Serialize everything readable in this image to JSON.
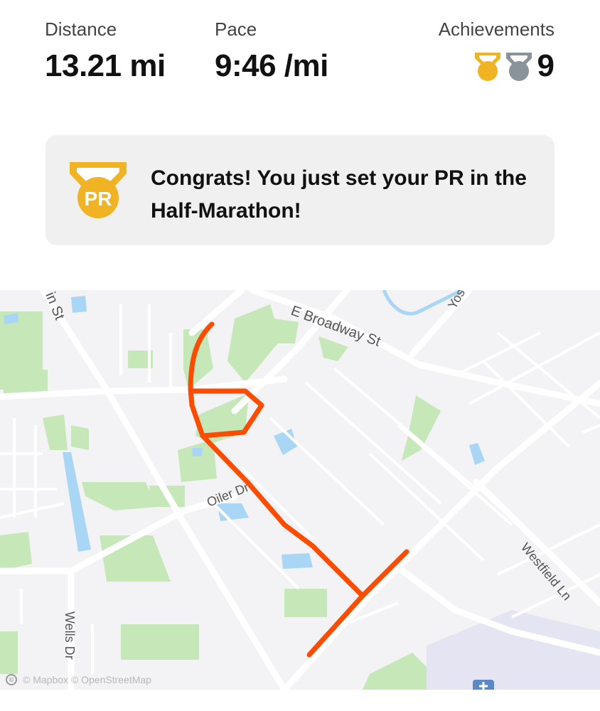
{
  "stats": {
    "distance": {
      "label": "Distance",
      "value": "13.21 mi"
    },
    "pace": {
      "label": "Pace",
      "value": "9:46 /mi"
    },
    "achievements": {
      "label": "Achievements",
      "count": "9",
      "icons": [
        "gold-medal-icon",
        "silver-medal-icon"
      ]
    }
  },
  "pr_card": {
    "badge_text": "PR",
    "message": "Congrats! You just set your PR in the Half-Marathon!",
    "icon": "pr-medal-icon"
  },
  "map": {
    "street_labels": {
      "broadway": "E Broadway St",
      "main": "in St",
      "oiler": "Oiler Dr",
      "westfield": "Westfield Ln",
      "wells": "Wells Dr",
      "yosemite": "Yos"
    },
    "attribution": "© Mapbox © OpenStreetMap",
    "logo_text": "©",
    "route_color": "#fc4c02"
  },
  "colors": {
    "gold": "#f0b323",
    "silver": "#8a9399",
    "park": "#c6e8b9",
    "water": "#a9d6f5",
    "road": "#ffffff",
    "background": "#f3f2f4"
  }
}
